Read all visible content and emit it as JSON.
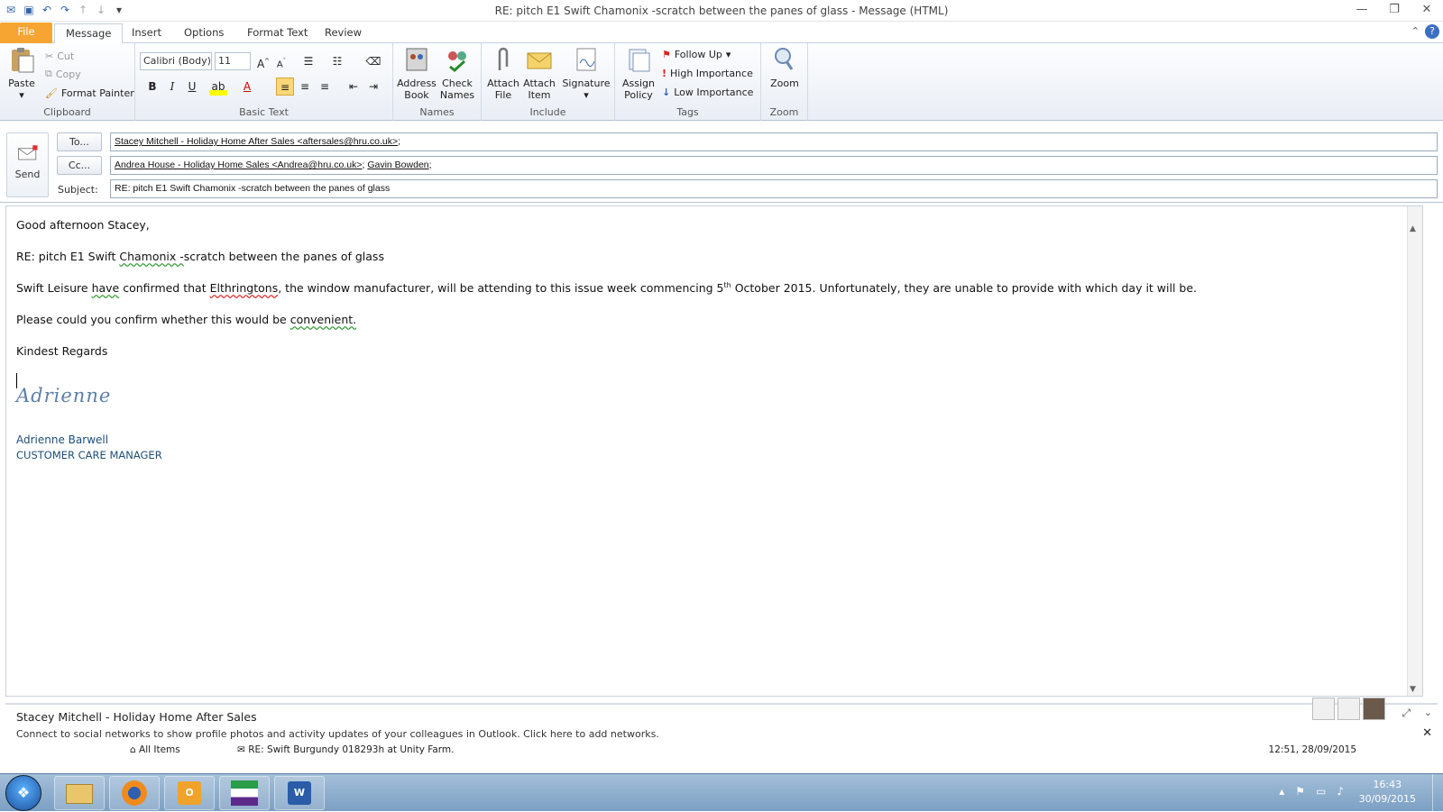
{
  "window": {
    "title": "RE: pitch E1 Swift Chamonix  -scratch between the panes of glass  -  Message (HTML)"
  },
  "tabs": [
    "File",
    "Message",
    "Insert",
    "Options",
    "Format Text",
    "Review"
  ],
  "ribbon": {
    "clipboard": {
      "paste": "Paste",
      "cut": "Cut",
      "copy": "Copy",
      "format_painter": "Format Painter",
      "label": "Clipboard"
    },
    "basic_text": {
      "font": "Calibri (Body)",
      "size": "11",
      "bold": "B",
      "italic": "I",
      "underline": "U",
      "label": "Basic Text"
    },
    "names": {
      "address_book": "Address Book",
      "check_names": "Check Names",
      "label": "Names"
    },
    "include": {
      "attach_file": "Attach File",
      "attach_item": "Attach Item",
      "signature": "Signature",
      "label": "Include"
    },
    "tags": {
      "assign_policy": "Assign Policy",
      "follow_up": "Follow Up",
      "high_importance": "High Importance",
      "low_importance": "Low Importance",
      "label": "Tags"
    },
    "zoom": {
      "zoom": "Zoom",
      "label": "Zoom"
    }
  },
  "header": {
    "send": "Send",
    "to_button": "To...",
    "cc_button": "Cc...",
    "subject_label": "Subject:",
    "to_recipient": "Stacey Mitchell - Holiday Home After Sales <aftersales@hru.co.uk>",
    "cc_recipient_1": "Andrea House - Holiday Home Sales <Andrea@hru.co.uk>",
    "cc_recipient_2": "Gavin Bowden",
    "subject": "RE: pitch E1 Swift Chamonix  -scratch between the panes of glass"
  },
  "body": {
    "greeting": "Good afternoon Stacey,",
    "re_prefix": "RE: pitch E1 Swift ",
    "re_word": "Chamonix  -",
    "re_suffix": "scratch between the panes of glass",
    "p1_a": "Swift Leisure ",
    "p1_b": "have",
    "p1_c": " confirmed that ",
    "p1_d": "Elthringtons",
    "p1_e": ", the window manufacturer, will be attending to this issue week commencing 5",
    "p1_sup": "th",
    "p1_f": " October 2015.  Unfortunately, they are unable to provide with which day it will be.",
    "p2_a": "Please could you confirm whether this would be ",
    "p2_b": "convenient.",
    "closing": "Kindest Regards",
    "signature_script": "Adrienne",
    "signature_name": "Adrienne Barwell",
    "signature_title": "CUSTOMER CARE MANAGER"
  },
  "people_pane": {
    "name": "Stacey Mitchell - Holiday Home After Sales",
    "notice": "Connect to social networks to show profile photos and activity updates of your colleagues in Outlook. Click here to add networks.",
    "item_folder": "All Items",
    "item_subject": "RE: Swift Burgundy 018293h at Unity Farm.",
    "item_date": "12:51, 28/09/2015"
  },
  "taskbar": {
    "time": "16:43",
    "date": "30/09/2015"
  },
  "colors": {
    "file_tab": "#f6a532",
    "ribbon_bg": "#e9eef5",
    "signature": "#1f4e79",
    "taskbar": "#7c9fc3"
  }
}
